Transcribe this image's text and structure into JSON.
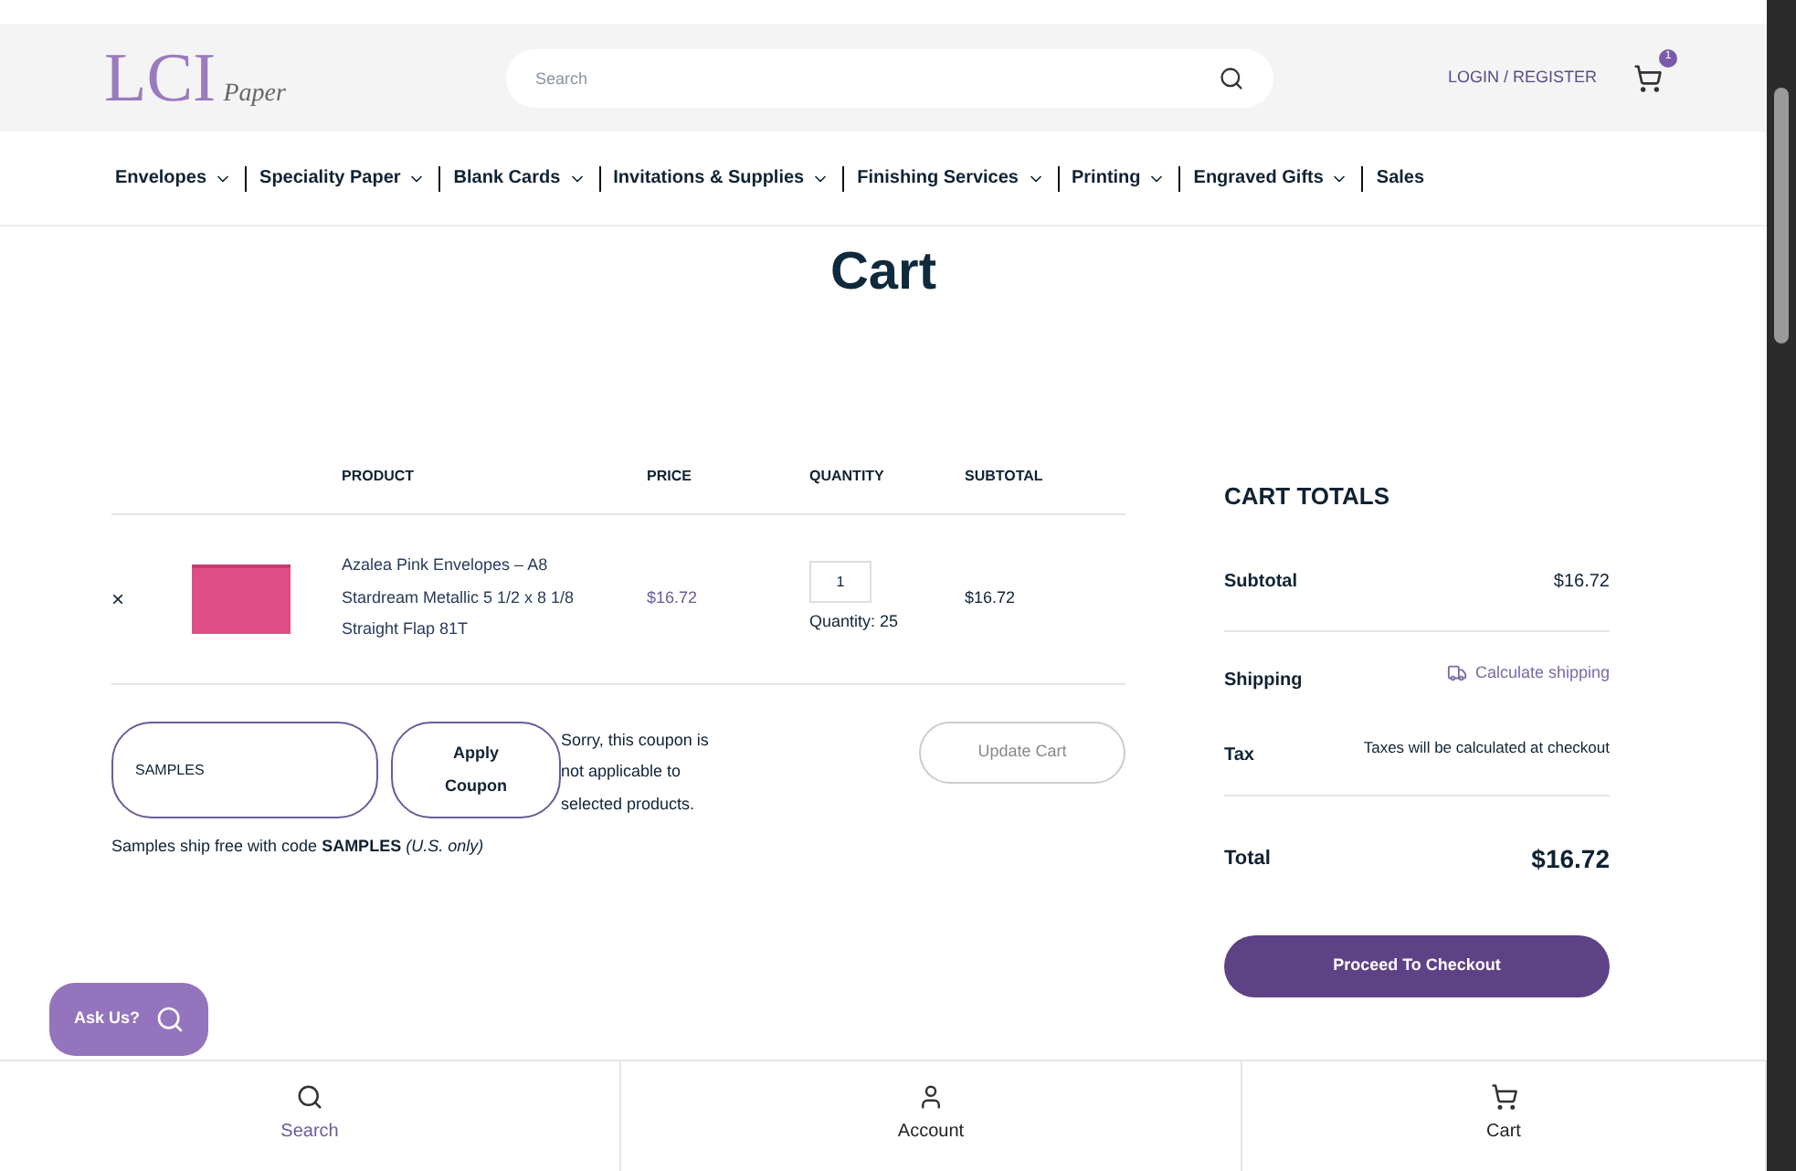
{
  "header": {
    "logo": {
      "main": "LCI",
      "sub": "Paper"
    },
    "search": {
      "placeholder": "Search"
    },
    "login": "LOGIN / REGISTER",
    "cart_count": "1"
  },
  "nav": [
    {
      "label": "Envelopes",
      "dropdown": true
    },
    {
      "label": "Speciality Paper",
      "dropdown": true
    },
    {
      "label": "Blank Cards",
      "dropdown": true
    },
    {
      "label": "Invitations & Supplies",
      "dropdown": true
    },
    {
      "label": "Finishing Services",
      "dropdown": true
    },
    {
      "label": "Printing",
      "dropdown": true
    },
    {
      "label": "Engraved Gifts",
      "dropdown": true
    },
    {
      "label": "Sales",
      "dropdown": false
    }
  ],
  "page_title": "Cart",
  "cart_table": {
    "columns": [
      "PRODUCT",
      "PRICE",
      "QUANTITY",
      "SUBTOTAL"
    ],
    "rows": [
      {
        "remove": "×",
        "name": "Azalea Pink Envelopes – A8 Stardream Metallic 5 1/2 x 8 1/8 Straight Flap 81T",
        "price": "$16.72",
        "quantity": "1",
        "quantity_note": "Quantity: 25",
        "subtotal": "$16.72"
      }
    ]
  },
  "coupon": {
    "value": "SAMPLES",
    "apply": "Apply Coupon",
    "message": "Sorry, this coupon is not applicable to selected products.",
    "update": "Update Cart",
    "note": "Samples ship free with code **SAMPLES** *(U.S. only)*"
  },
  "totals": {
    "title": "CART TOTALS",
    "subtotal_label": "Subtotal",
    "subtotal": "$16.72",
    "shipping_label": "Shipping",
    "shipping": "Calculate shipping",
    "tax_label": "Tax",
    "tax": "Taxes will be calculated at checkout",
    "total_label": "Total",
    "total": "$16.72",
    "checkout": "Proceed To Checkout"
  },
  "ask": "Ask Us?",
  "bottom_nav": [
    {
      "label": "Search",
      "kind": "search",
      "selected": true
    },
    {
      "label": "Account",
      "kind": "account",
      "selected": false
    },
    {
      "label": "Cart",
      "kind": "cart",
      "selected": false
    }
  ]
}
